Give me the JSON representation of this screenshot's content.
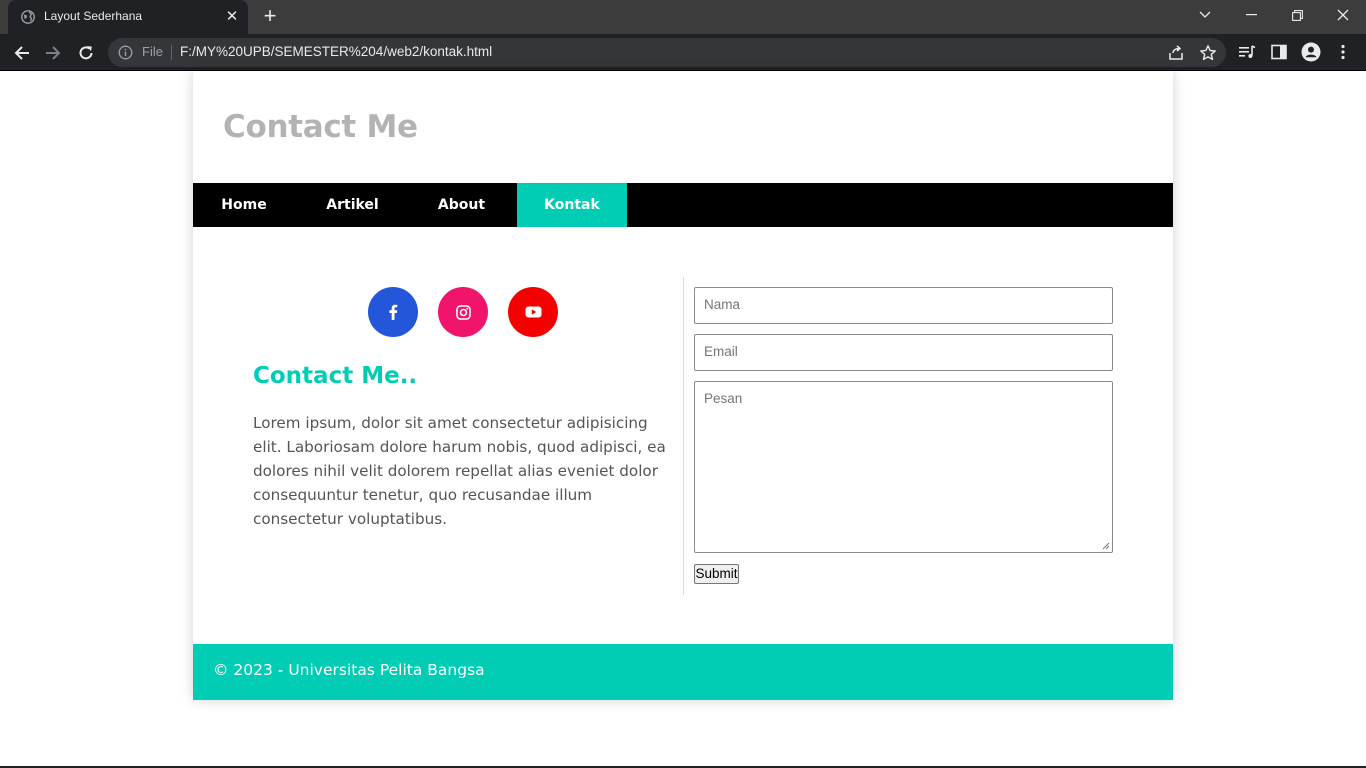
{
  "browser": {
    "tab_title": "Layout Sederhana",
    "tab_close": "✕",
    "new_tab": "+",
    "security_label": "File",
    "url": "F:/MY%20UPB/SEMESTER%204/web2/kontak.html"
  },
  "site": {
    "title": "Contact Me",
    "nav": [
      {
        "label": "Home",
        "active": false
      },
      {
        "label": "Artikel",
        "active": false
      },
      {
        "label": "About",
        "active": false
      },
      {
        "label": "Kontak",
        "active": true
      }
    ]
  },
  "contact": {
    "social": [
      {
        "icon": "facebook-icon",
        "color": "#2356d9"
      },
      {
        "icon": "instagram-icon",
        "color": "#f0146a"
      },
      {
        "icon": "youtube-icon",
        "color": "#f40000"
      }
    ],
    "heading": "Contact Me..",
    "body": "Lorem ipsum, dolor sit amet consectetur adipisicing elit. Laboriosam dolore harum nobis, quod adipisci, ea dolores nihil velit dolorem repellat alias eveniet dolor consequuntur tenetur, quo recusandae illum consectetur voluptatibus."
  },
  "form": {
    "name_placeholder": "Nama",
    "email_placeholder": "Email",
    "message_placeholder": "Pesan",
    "submit_label": "Submit"
  },
  "footer": {
    "text": "© 2023 - Universitas Pelita Bangsa"
  },
  "colors": {
    "accent": "#00cdb4",
    "navbar": "#000000",
    "title_gray": "#b3b3b3"
  }
}
